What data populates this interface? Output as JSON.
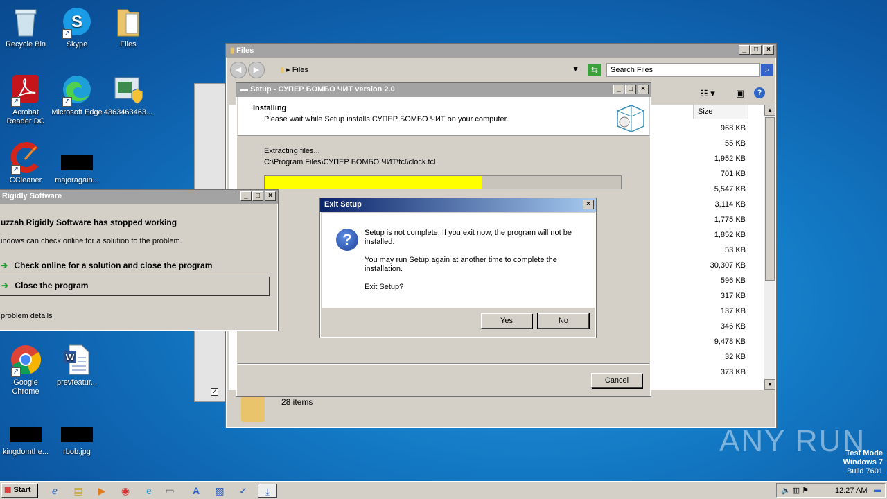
{
  "desktop_icons": [
    {
      "label": "Recycle Bin",
      "icon": "recycle-bin-icon"
    },
    {
      "label": "Skype",
      "icon": "skype-icon"
    },
    {
      "label": "Files",
      "icon": "folder-icon"
    },
    {
      "label": "Acrobat Reader DC",
      "icon": "acrobat-icon"
    },
    {
      "label": "Microsoft Edge",
      "icon": "edge-icon"
    },
    {
      "label": "4363463463...",
      "icon": "installer-icon"
    },
    {
      "label": "CCleaner",
      "icon": "ccleaner-icon"
    },
    {
      "label": "majoragain...",
      "icon": "black-file-icon"
    },
    {
      "label": "Google Chrome",
      "icon": "chrome-icon"
    },
    {
      "label": "prevfeatur...",
      "icon": "word-doc-icon"
    },
    {
      "label": "kingdomthe...",
      "icon": "black-file-icon"
    },
    {
      "label": "rbob.jpg",
      "icon": "black-file-icon"
    }
  ],
  "explorer": {
    "title": "Files",
    "address": "Files",
    "search_placeholder": "Search Files",
    "column_size": "Size",
    "sizes": [
      "968 KB",
      "55 KB",
      "1,952 KB",
      "701 KB",
      "5,547 KB",
      "3,114 KB",
      "1,775 KB",
      "1,852 KB",
      "53 KB",
      "30,307 KB",
      "596 KB",
      "317 KB",
      "137 KB",
      "346 KB",
      "9,478 KB",
      "32 KB",
      "373 KB"
    ],
    "status": "28 items"
  },
  "setup": {
    "title": "Setup - СУПЕР БОМБО ЧИТ version 2.0",
    "heading": "Installing",
    "subheading": "Please wait while Setup installs СУПЕР БОМБО ЧИТ on your computer.",
    "extracting": "Extracting files...",
    "path": "C:\\Program Files\\СУПЕР БОМБО ЧИТ\\tcl\\clock.tcl",
    "progress": 0.61,
    "cancel": "Cancel"
  },
  "crash": {
    "title": "Rigidly Software",
    "heading": "uzzah Rigidly Software has stopped working",
    "desc": "indows can check online for a solution to the problem.",
    "opt1": "Check online for a solution and close the program",
    "opt2": "Close the program",
    "details": "problem details"
  },
  "exit_dialog": {
    "title": "Exit Setup",
    "line1": "Setup is not complete. If you exit now, the program will not be installed.",
    "line2": "You may run Setup again at another time to complete the installation.",
    "line3": "Exit Setup?",
    "yes": "Yes",
    "no": "No"
  },
  "watermark": {
    "brand": "ANY RUN",
    "mode": "Test Mode",
    "os": "Windows 7",
    "build": "Build 7601"
  },
  "taskbar": {
    "start": "Start",
    "time": "12:27 AM"
  }
}
